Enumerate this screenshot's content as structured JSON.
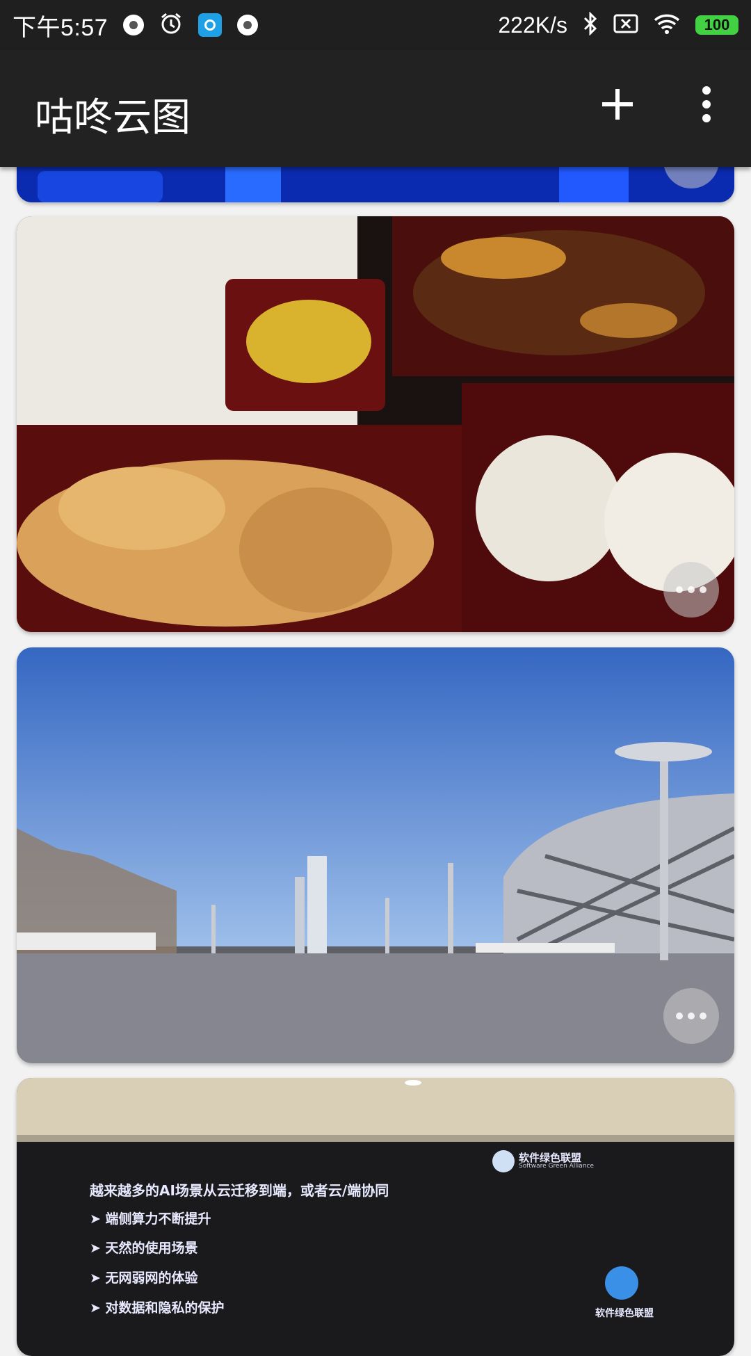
{
  "status_bar": {
    "time": "下午5:57",
    "speed": "222K/s",
    "battery": "100",
    "icons": [
      "notification-dot-icon",
      "alarm-icon",
      "app-notification-icon",
      "notification-dot-icon",
      "bluetooth-icon",
      "no-sim-icon",
      "wifi-icon",
      "battery-icon"
    ]
  },
  "appbar": {
    "title": "咕咚云图",
    "actions": [
      "add-icon",
      "more-vert-icon"
    ]
  },
  "photos": [
    {
      "subject": "blue-lit-interior"
    },
    {
      "subject": "bento-meal"
    },
    {
      "subject": "bird-nest-stadium-plaza"
    },
    {
      "subject": "presentation-slide"
    }
  ],
  "slide": {
    "logo_text": "软件绿色联盟",
    "logo_subtext": "Software Green Alliance",
    "heading": "越来越多的AI场景从云迁移到端，或者云/端协同",
    "bullets": [
      "端侧算力不断提升",
      "天然的使用场景",
      "无网弱网的体验",
      "对数据和隐私的保护"
    ],
    "logo2_text": "软件绿色联盟"
  },
  "colors": {
    "appbar": "#222222",
    "statusbar": "#1f1f1f",
    "background": "#f2f2f2",
    "battery": "#42d142"
  }
}
